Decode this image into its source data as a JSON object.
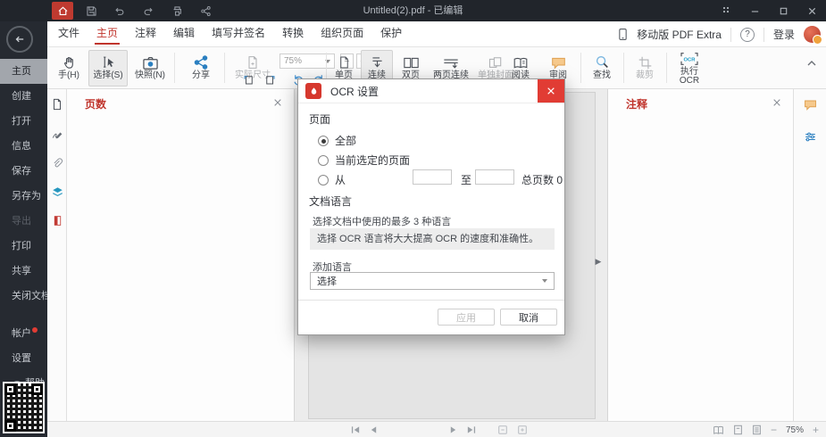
{
  "colors": {
    "accent_red": "#c0342c",
    "brand_red": "#d6382e",
    "close_red": "#e13c34",
    "titlebar_bg": "#21252b",
    "sidebar_bg": "#262a31",
    "link_blue": "#2a7fc0",
    "review_orange": "#f3b25f"
  },
  "titlebar": {
    "title": "Untitled(2).pdf - 已编辑"
  },
  "menubar": {
    "tabs": [
      {
        "label": "文件"
      },
      {
        "label": "主页"
      },
      {
        "label": "注释"
      },
      {
        "label": "编辑"
      },
      {
        "label": "填写并签名"
      },
      {
        "label": "转换"
      },
      {
        "label": "组织页面"
      },
      {
        "label": "保护"
      }
    ],
    "mobile_link": "移动版 PDF Extra",
    "login": "登录"
  },
  "toolbar": {
    "hand": "手(H)",
    "select": "选择(S)",
    "snapshot": "快照(N)",
    "share": "分享",
    "actual_size": "实际尺寸",
    "zoom_value": "75%",
    "single_page": "单页",
    "continuous": "连续",
    "facing": "双页",
    "facing_continuous": "两页连续",
    "separate_cover": "单独封面",
    "read": "阅读",
    "review": "审阅",
    "find": "查找",
    "crop": "裁剪",
    "run_ocr": "执行OCR"
  },
  "sidebar": {
    "items": [
      {
        "label": "主页"
      },
      {
        "label": "创建"
      },
      {
        "label": "打开"
      },
      {
        "label": "信息"
      },
      {
        "label": "保存"
      },
      {
        "label": "另存为"
      },
      {
        "label": "导出"
      },
      {
        "label": "打印"
      },
      {
        "label": "共享"
      },
      {
        "label": "关闭文档"
      },
      {
        "label": "帐户"
      },
      {
        "label": "设置"
      },
      {
        "label": "帮助"
      }
    ]
  },
  "left_panel": {
    "title": "页数"
  },
  "right_panel": {
    "title": "注释"
  },
  "dialog": {
    "title": "OCR 设置",
    "section_pages": "页面",
    "radio_all": "全部",
    "radio_current": "当前选定的页面",
    "radio_from": "从",
    "to_label": "至",
    "from_value": "",
    "to_value": "",
    "total_pages_label": "总页数 0",
    "section_language": "文档语言",
    "language_hint": "选择文档中使用的最多 3 种语言",
    "language_info": "选择 OCR 语言将大大提高 OCR 的速度和准确性。",
    "add_language_label": "添加语言",
    "language_select_value": "选择",
    "apply_label": "应用",
    "cancel_label": "取消"
  },
  "statusbar": {
    "zoom": "75%"
  }
}
